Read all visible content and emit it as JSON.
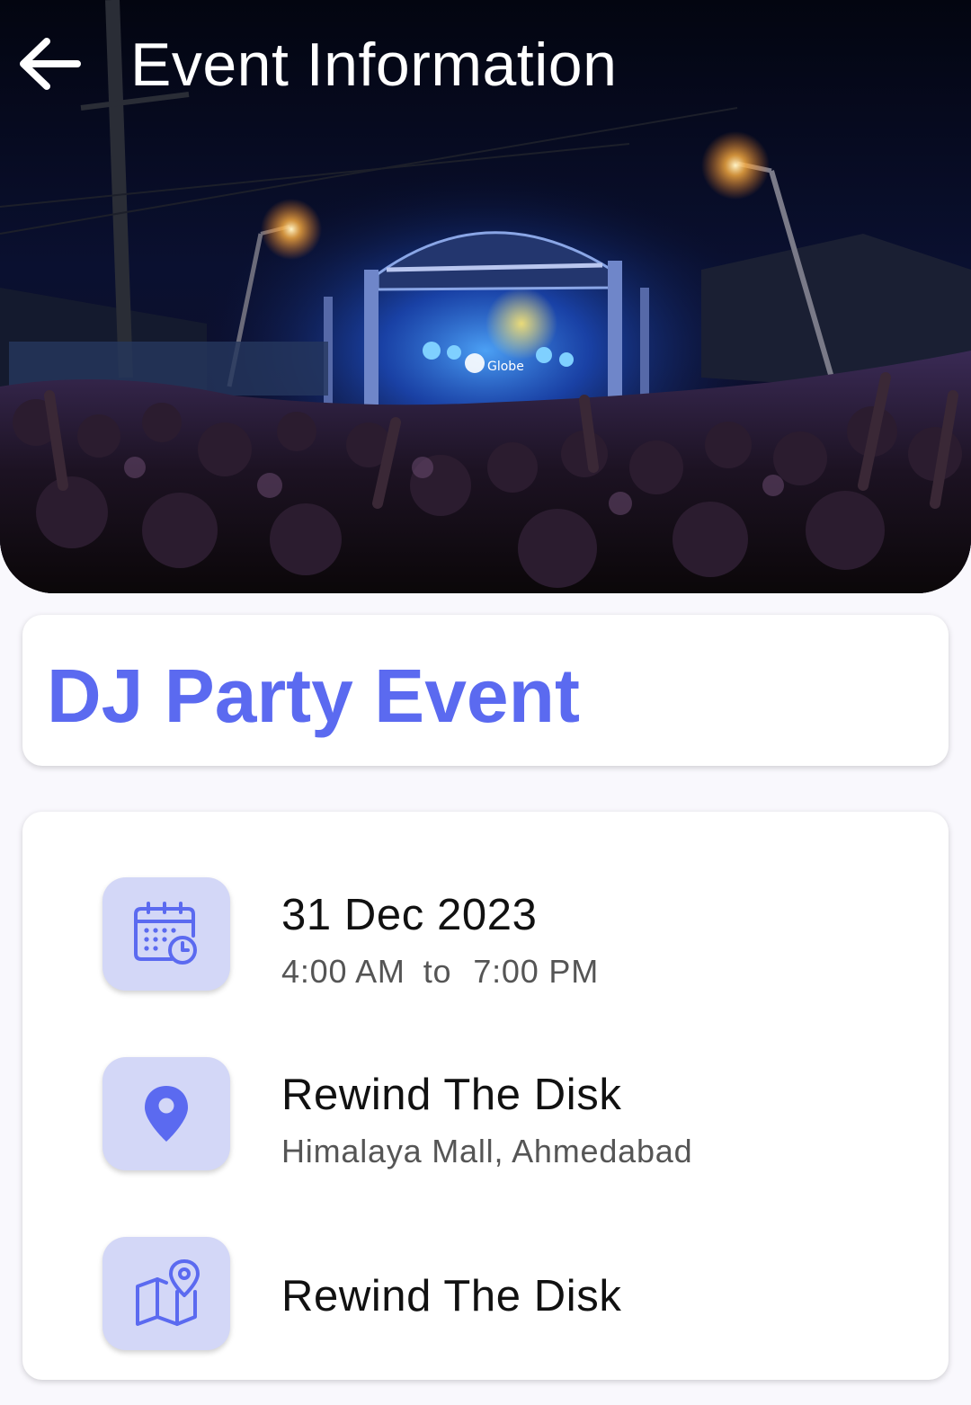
{
  "header": {
    "title": "Event Information"
  },
  "hero": {
    "stage_sign": "Globe"
  },
  "event": {
    "name": "DJ Party Event",
    "date": "31 Dec 2023",
    "start_time": "4:00 AM",
    "time_separator": "to",
    "end_time": "7:00 PM",
    "venue_name": "Rewind The Disk",
    "venue_address": "Himalaya Mall, Ahmedabad",
    "map_label": "Rewind The Disk"
  },
  "theme": {
    "accent": "#5b6af0",
    "icon_tile": "#d3d7f7"
  }
}
